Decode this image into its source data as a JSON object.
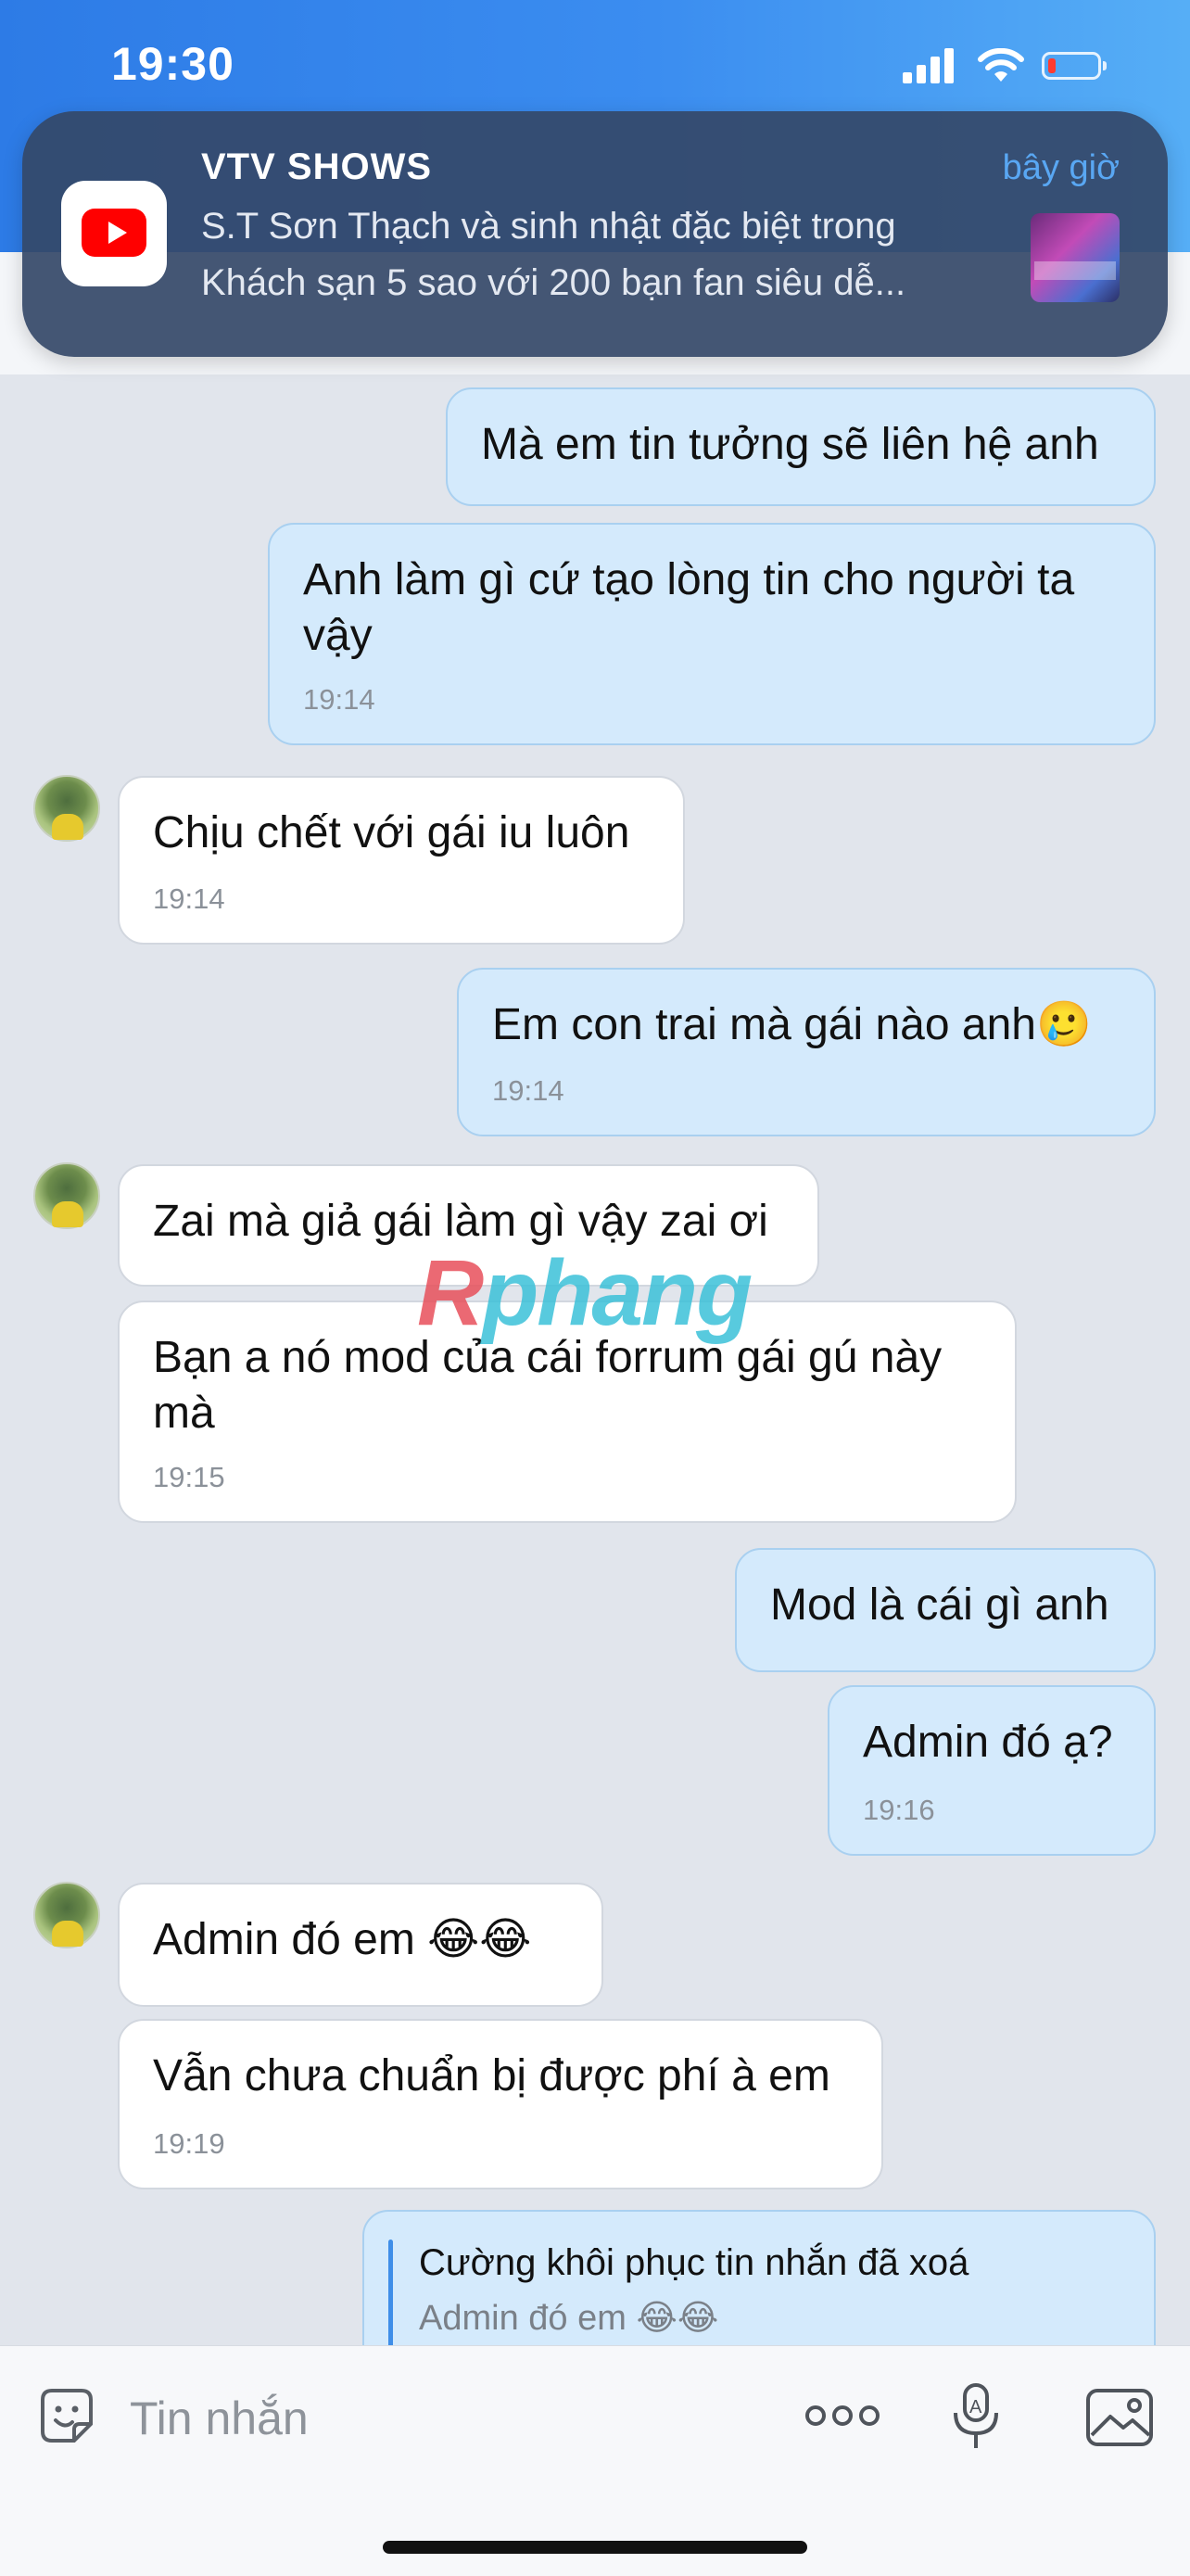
{
  "status_bar": {
    "time": "19:30"
  },
  "notification": {
    "app": "VTV SHOWS",
    "time": "bây giờ",
    "line1": "S.T Sơn Thạch và sinh nhật đặc biệt trong",
    "line2": "Khách sạn 5 sao với 200 bạn fan siêu dễ...",
    "icon": "youtube-icon"
  },
  "messages": [
    {
      "dir": "out",
      "text": "Mà em tin tưởng sẽ liên hệ anh",
      "time": ""
    },
    {
      "dir": "out",
      "text": "Anh làm gì cứ tạo lòng tin cho người ta vậy",
      "time": "19:14"
    },
    {
      "dir": "in",
      "text": "Chịu chết với gái iu luôn",
      "time": "19:14"
    },
    {
      "dir": "out",
      "text": "Em con trai mà gái nào anh🥲",
      "time": "19:14"
    },
    {
      "dir": "in",
      "text": "Zai mà giả gái làm gì vậy zai ơi",
      "time": ""
    },
    {
      "dir": "in",
      "text": "Bạn a nó mod của cái forrum gái gú này mà",
      "time": "19:15"
    },
    {
      "dir": "out",
      "text": "Mod là cái gì anh",
      "time": ""
    },
    {
      "dir": "out",
      "text": "Admin đó ạ?",
      "time": "19:16"
    },
    {
      "dir": "in",
      "text": "Admin đó em 😂😂",
      "time": ""
    },
    {
      "dir": "in",
      "text": "Vẫn chưa chuẩn bị được phí à em",
      "time": "19:19"
    }
  ],
  "reply_quote": {
    "name": "Cường khôi phục tin nhắn đã xoá",
    "text": "Admin đó em 😂😂"
  },
  "watermark": {
    "part1": "R",
    "part2": "phang"
  },
  "composer": {
    "placeholder": "Tin nhắn"
  },
  "colors": {
    "outgoing_bubble": "#d4eafc",
    "incoming_bubble": "#ffffff",
    "header_blue": "#2d7be6"
  }
}
